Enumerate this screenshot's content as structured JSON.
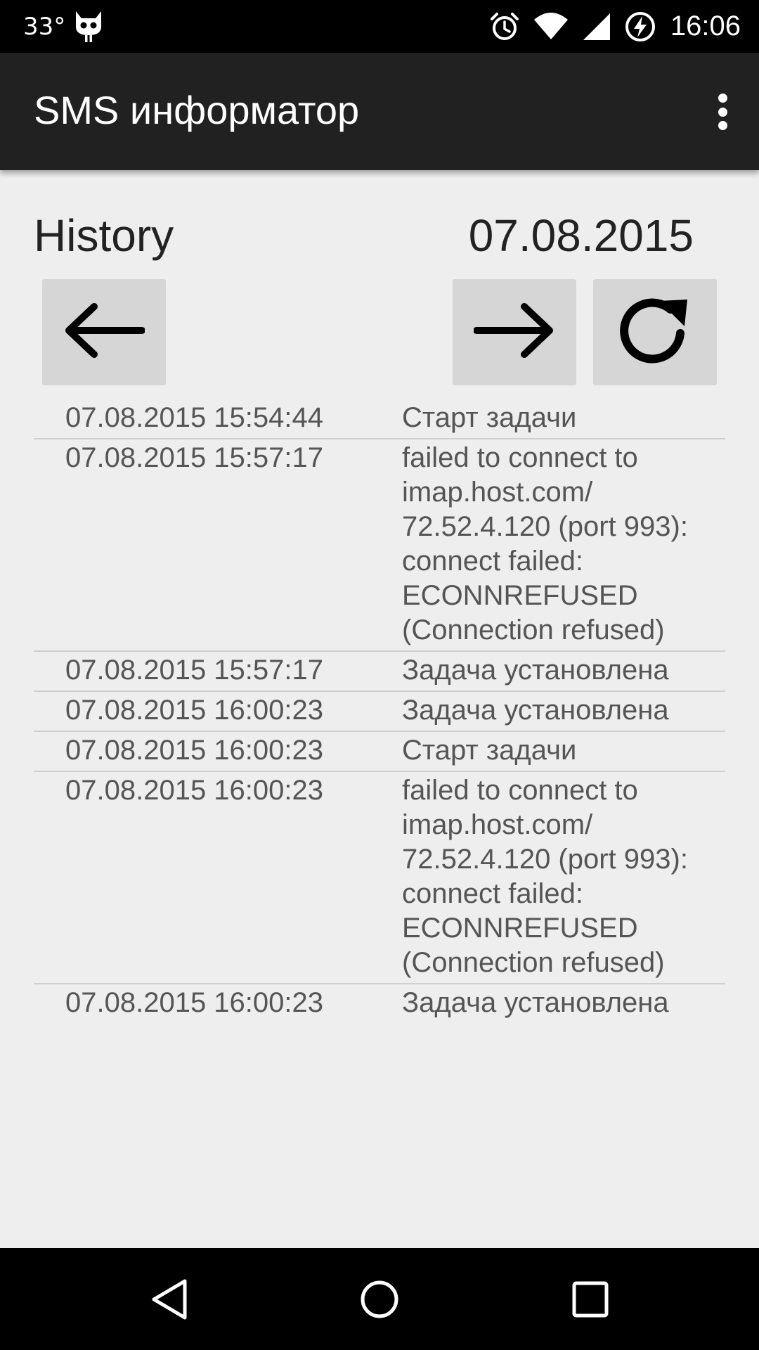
{
  "status_bar": {
    "temperature": "33°",
    "time": "16:06",
    "icons": [
      "cyanogen-icon",
      "alarm-icon",
      "wifi-icon",
      "signal-icon",
      "battery-charging-icon"
    ]
  },
  "toolbar": {
    "title": "SMS информатор",
    "menu_icon": "more-vert-icon"
  },
  "header": {
    "label": "History",
    "date": "07.08.2015"
  },
  "buttons": {
    "prev_icon": "arrow-left-icon",
    "next_icon": "arrow-right-icon",
    "refresh_icon": "refresh-icon"
  },
  "history": [
    {
      "time": "07.08.2015 15:54:44",
      "message": "Старт задачи"
    },
    {
      "time": "07.08.2015 15:57:17",
      "message": "failed to connect to imap.host.com/ 72.52.4.120 (port 993): connect failed: ECONNREFUSED (Connection refused)"
    },
    {
      "time": "07.08.2015 15:57:17",
      "message": "Задача установлена"
    },
    {
      "time": "07.08.2015 16:00:23",
      "message": "Задача установлена"
    },
    {
      "time": "07.08.2015 16:00:23",
      "message": "Старт задачи"
    },
    {
      "time": "07.08.2015 16:00:23",
      "message": "failed to connect to imap.host.com/ 72.52.4.120 (port 993): connect failed: ECONNREFUSED (Connection refused)"
    },
    {
      "time": "07.08.2015 16:00:23",
      "message": "Задача установлена"
    }
  ],
  "nav_bar": {
    "icons": [
      "back-icon",
      "home-icon",
      "recents-icon"
    ]
  },
  "colors": {
    "status_bar": "#000000",
    "toolbar": "#212121",
    "background": "#eeeeee",
    "button": "#d6d6d6",
    "row_text": "#555555",
    "divider": "#cfcfcf"
  }
}
